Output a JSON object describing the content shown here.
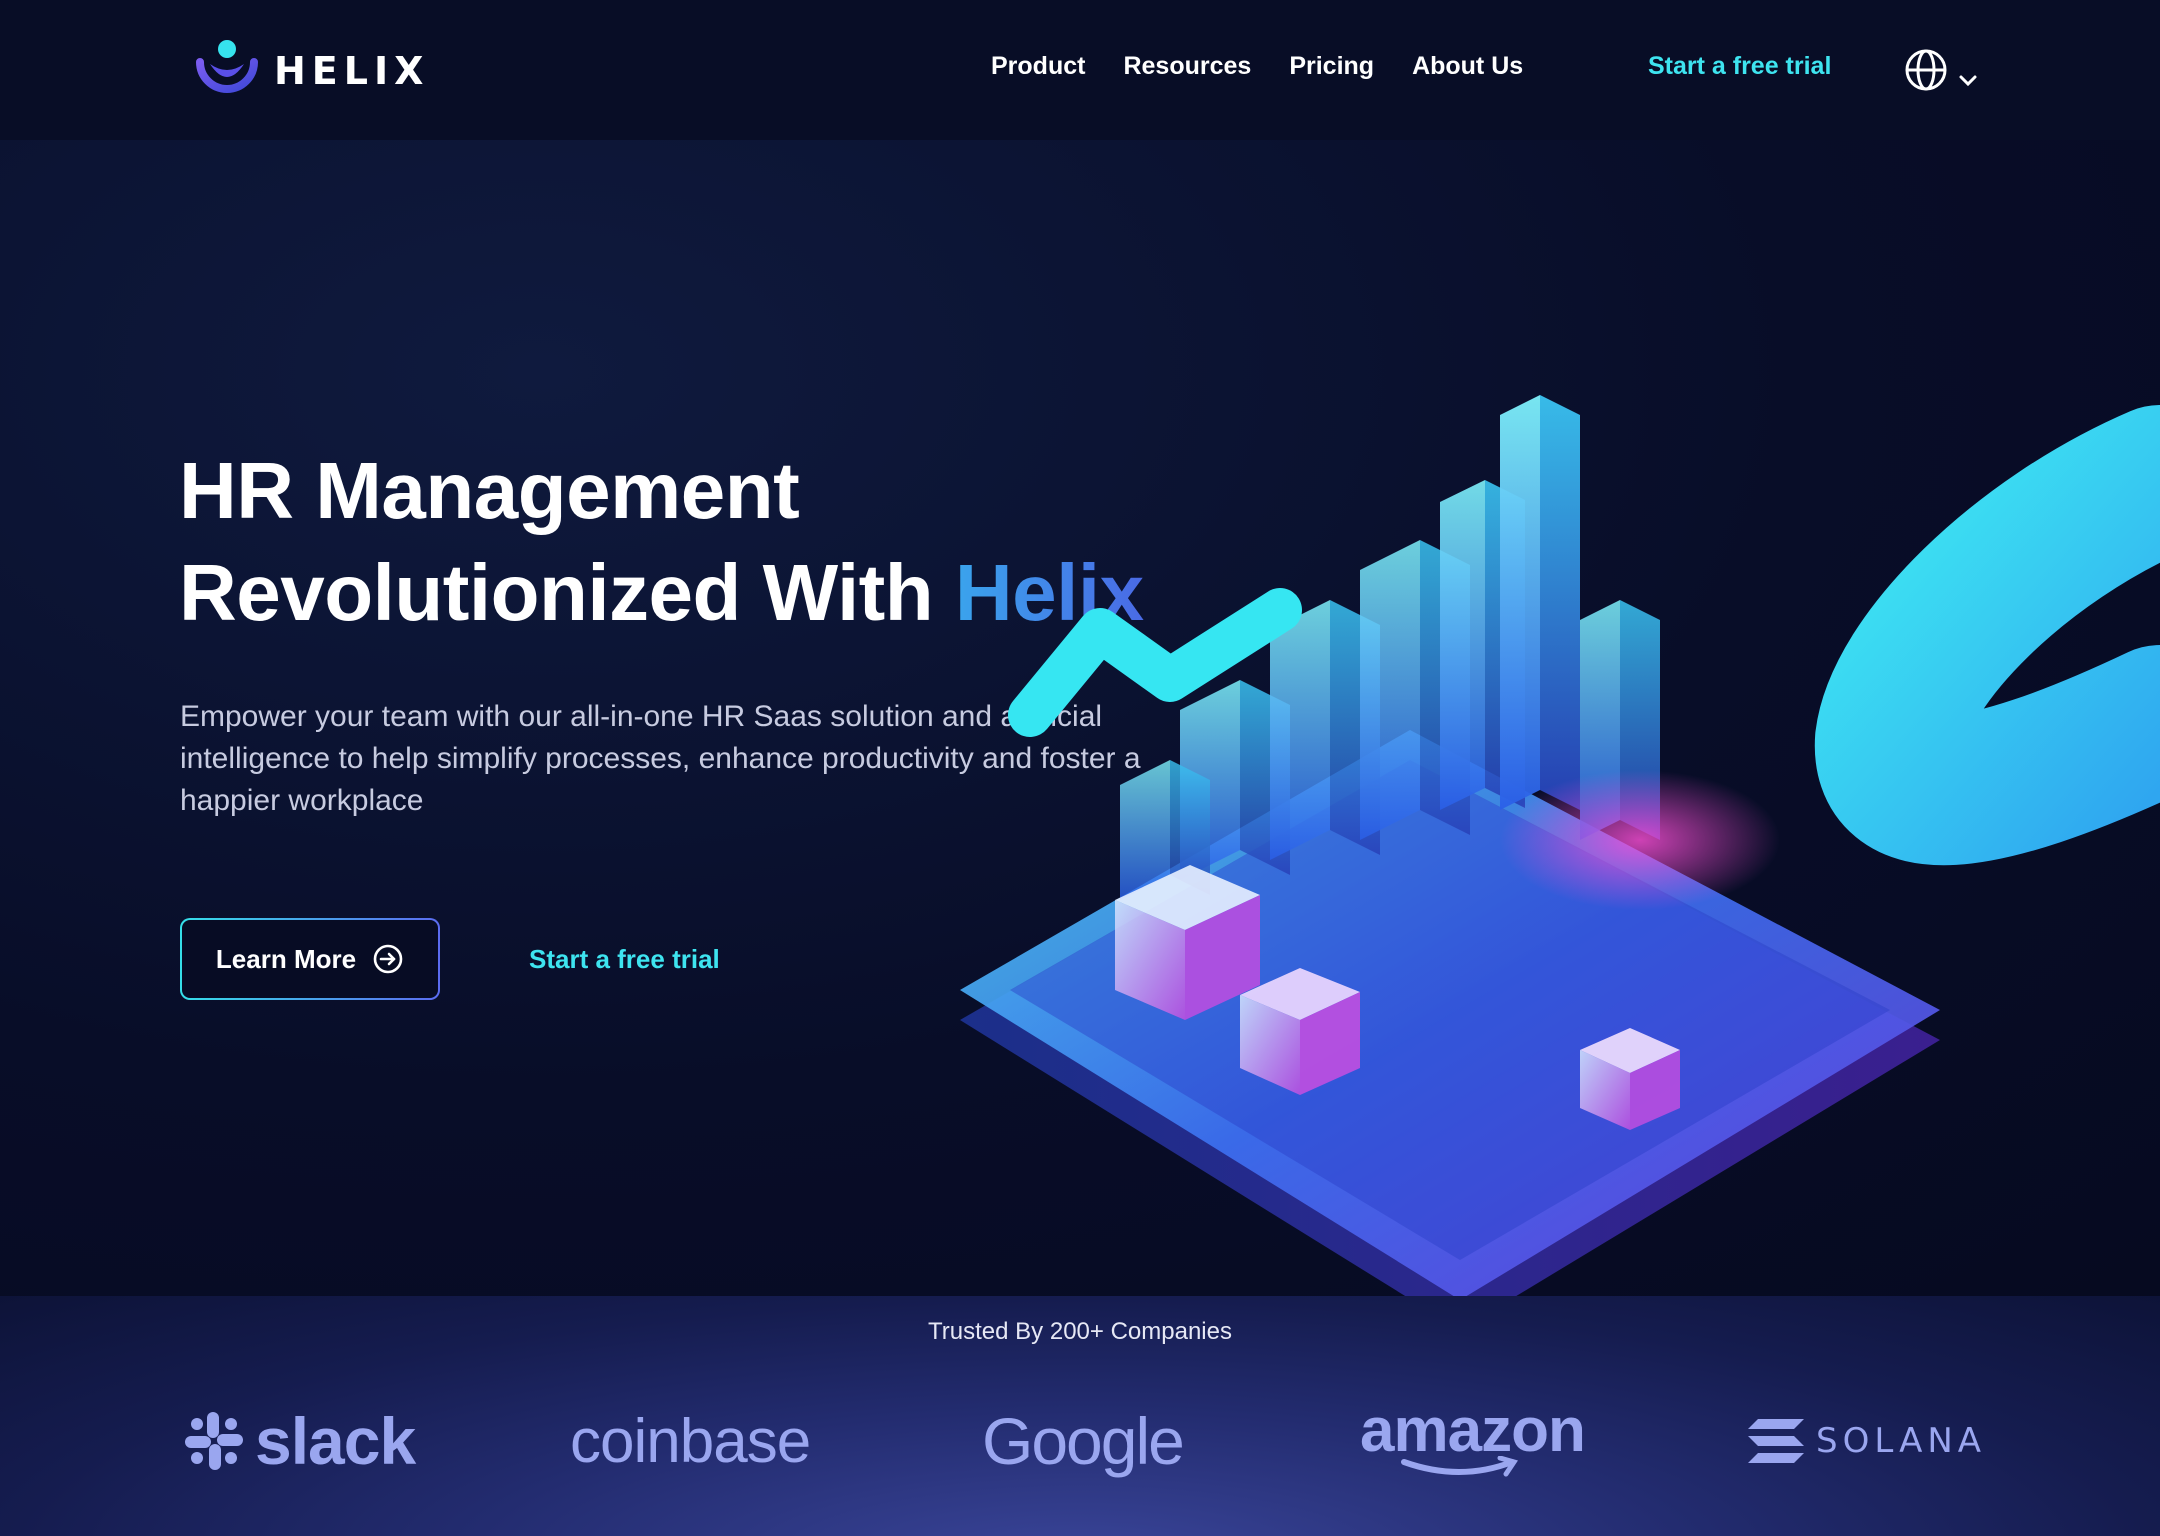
{
  "brand": {
    "name": "HELIX"
  },
  "nav": {
    "links": [
      "Product",
      "Resources",
      "Pricing",
      "About Us"
    ],
    "cta": "Start a free trial"
  },
  "hero": {
    "title_line1": "HR Management",
    "title_line2": "Revolutionized With ",
    "title_accent": "Helix",
    "description": "Empower your team with our all-in-one HR Saas solution and artificial intelligence to help simplify processes, enhance productivity and foster a happier workplace",
    "learn_more": "Learn More",
    "trial": "Start a free trial"
  },
  "trusted": {
    "label": "Trusted By 200+ Companies",
    "companies": [
      "slack",
      "coinbase",
      "Google",
      "amazon",
      "SOLANA"
    ]
  },
  "colors": {
    "background": "#070c24",
    "accent_cyan": "#3ee4f0",
    "accent_blue": "#4a6ae6",
    "logo_muted": "#9aa6ef"
  },
  "icons": {
    "logo": "helix-logo-icon",
    "language": "globe-icon",
    "language_chevron": "chevron-down-icon",
    "learn_more": "arrow-right-circle-icon"
  }
}
